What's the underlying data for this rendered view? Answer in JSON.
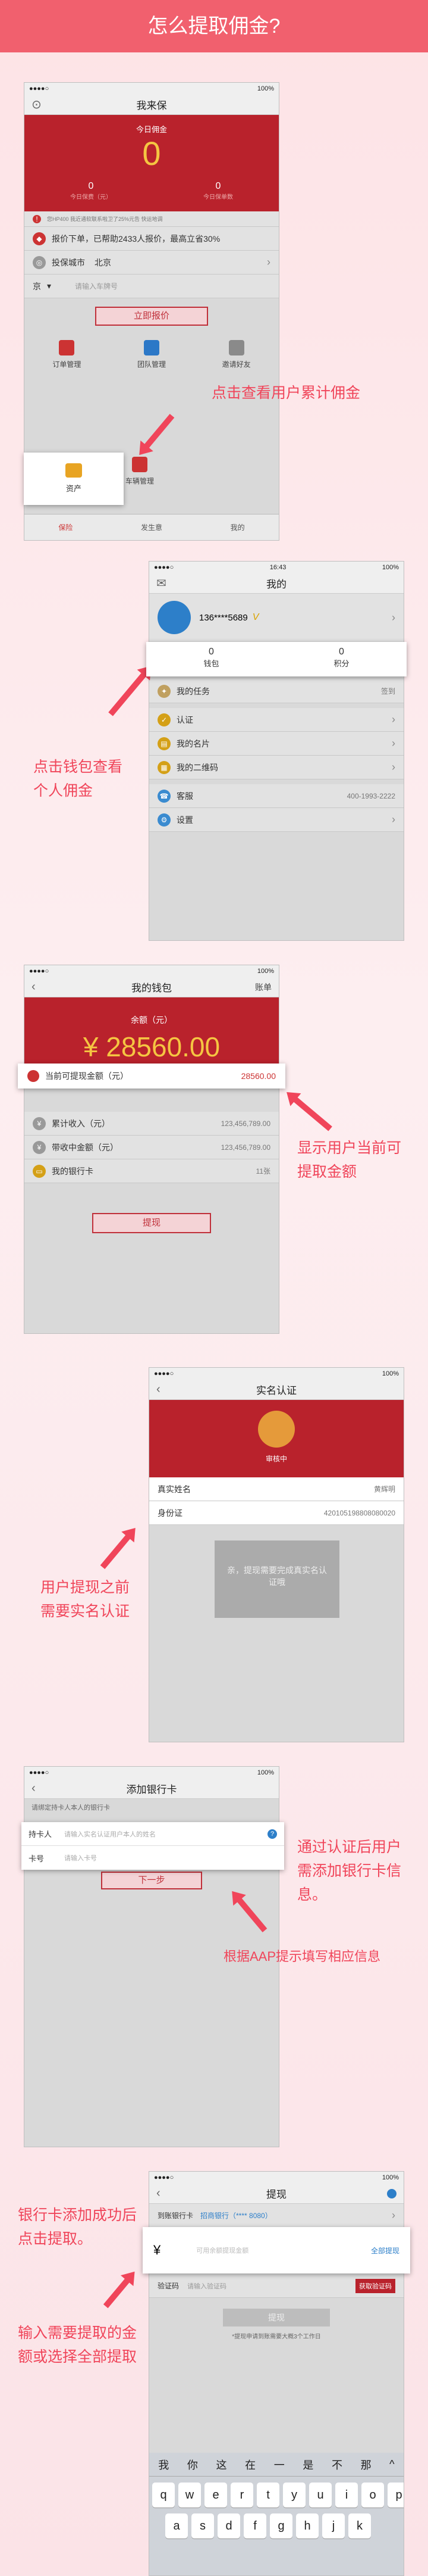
{
  "page_title": "怎么提取佣金?",
  "s1": {
    "status": "100%",
    "title": "我来保",
    "today_label": "今日佣金",
    "today_value": "0",
    "stat1_value": "0",
    "stat1_label": "今日保费（元）",
    "stat2_value": "0",
    "stat2_label": "今日保单数",
    "ticker": "您HP400 我近通软联系啦卫了25%元告 快运地调",
    "promo": "报价下单，已帮助2433人报价，最高立省30%",
    "city_label": "投保城市",
    "city_value": "北京",
    "plate_prefix": "京",
    "plate_placeholder": "请输入车牌号",
    "quote_btn": "立即报价",
    "menu": [
      "订单管理",
      "团队管理",
      "邀请好友"
    ],
    "asset": "资产",
    "vehicle": "车辆管理",
    "tabs": [
      "保险",
      "发生意",
      "我的"
    ],
    "caption": "点击查看用户累计佣金"
  },
  "s2": {
    "time": "16:43",
    "status": "100%",
    "title": "我的",
    "phone": "136****5689",
    "vip": "V",
    "wallet_value": "0",
    "wallet_label": "钱包",
    "points_value": "0",
    "points_label": "积分",
    "rows": [
      {
        "label": "我的任务",
        "value": "签到"
      },
      {
        "label": "认证",
        "value": ""
      },
      {
        "label": "我的名片",
        "value": ""
      },
      {
        "label": "我的二维码",
        "value": ""
      },
      {
        "label": "客服",
        "value": "400-1993-2222"
      },
      {
        "label": "设置",
        "value": ""
      }
    ],
    "caption": "点击钱包查看个人佣金"
  },
  "s3": {
    "status": "100%",
    "title": "我的钱包",
    "right": "账单",
    "balance_label": "余额（元）",
    "balance": "¥ 28560.00",
    "hl_label": "当前可提现金额（元）",
    "hl_value": "28560.00",
    "rows": [
      {
        "label": "累计收入（元）",
        "value": "123,456,789.00"
      },
      {
        "label": "带收中金额（元）",
        "value": "123,456,789.00"
      },
      {
        "label": "我的银行卡",
        "value": "11张"
      }
    ],
    "btn": "提现",
    "caption": "显示用户当前可提取金额"
  },
  "s4": {
    "status": "100%",
    "title": "实名认证",
    "audit": "审核中",
    "name_label": "真实姓名",
    "name_value": "黄辉明",
    "id_label": "身份证",
    "id_value": "420105198808080020",
    "overlay": "亲，提现需要完成真实名认证哦",
    "caption": "用户提现之前需要实名认证"
  },
  "s5": {
    "status": "100%",
    "title": "添加银行卡",
    "hint": "请绑定持卡人本人的银行卡",
    "holder_label": "持卡人",
    "holder_placeholder": "请输入实名认证用户本人的姓名",
    "card_label": "卡号",
    "card_placeholder": "请输入卡号",
    "next": "下一步",
    "caption1": "通过认证后用户需添加银行卡信息。",
    "caption2": "根据AAP提示填写相应信息"
  },
  "s6": {
    "status": "100%",
    "title": "提现",
    "bank_label": "到账银行卡",
    "bank_value": "招商银行（**** 8080）",
    "yen": "¥",
    "amount_placeholder": "可用余额提现金额",
    "all_btn": "全部提现",
    "code_label": "验证码",
    "code_placeholder": "请输入验证码",
    "code_btn": "获取验证码",
    "submit": "提现",
    "note": "*提现申请到账需要大概3个工作日",
    "cands": [
      "我",
      "你",
      "这",
      "在",
      "一",
      "是",
      "不",
      "那"
    ],
    "keys": [
      "q",
      "w",
      "e",
      "r",
      "t",
      "y",
      "u",
      "i",
      "o",
      "p"
    ],
    "keys2": [
      "a",
      "s",
      "d",
      "f",
      "g",
      "h",
      "j",
      "k"
    ],
    "caption1": "银行卡添加成功后点击提取。",
    "caption2": "输入需要提取的金额或选择全部提取"
  }
}
